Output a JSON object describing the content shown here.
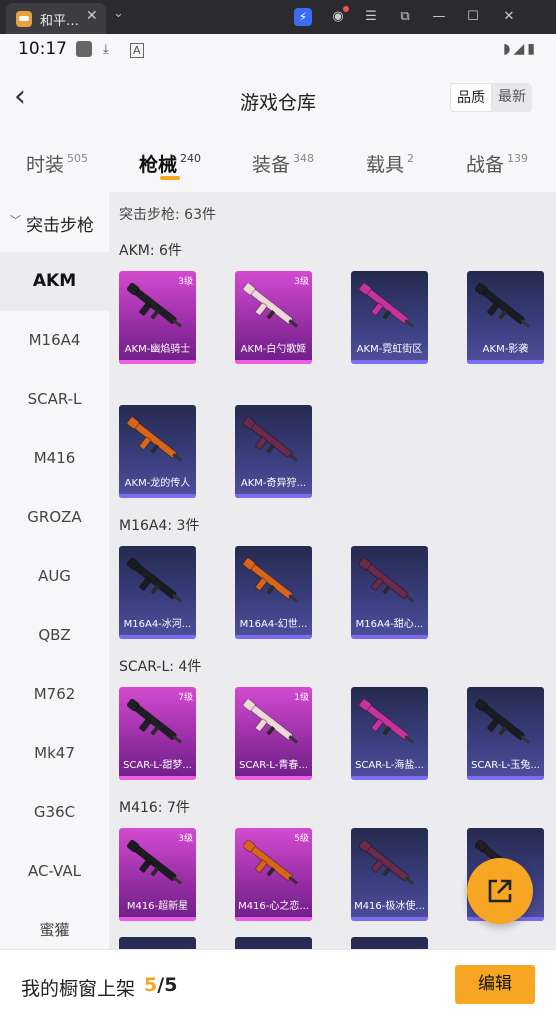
{
  "window": {
    "title": "和平…",
    "favicon": "game-app-icon"
  },
  "status_bar": {
    "time": "10:17"
  },
  "header": {
    "title": "游戏仓库",
    "sort": [
      "品质",
      "最新"
    ]
  },
  "categories": [
    {
      "label": "时装",
      "count": "505"
    },
    {
      "label": "枪械",
      "count": "240"
    },
    {
      "label": "装备",
      "count": "348"
    },
    {
      "label": "载具",
      "count": "2"
    },
    {
      "label": "战备",
      "count": "139"
    }
  ],
  "active_category": "枪械",
  "sidebar": {
    "group": "突击步枪",
    "items": [
      "AKM",
      "M16A4",
      "SCAR-L",
      "M416",
      "GROZA",
      "AUG",
      "QBZ",
      "M762",
      "Mk47",
      "G36C",
      "AC-VAL",
      "蜜獾"
    ],
    "active": "AKM"
  },
  "summary": "突击步枪: 63件",
  "sections": [
    {
      "title": "AKM: 6件",
      "items": [
        {
          "name": "AKM-幽焰骑士",
          "level": "3级",
          "rarity": "pink"
        },
        {
          "name": "AKM-白勺歌姬",
          "level": "3级",
          "rarity": "pink"
        },
        {
          "name": "AKM-霓虹街区",
          "level": "",
          "rarity": "blue"
        },
        {
          "name": "AKM-影袭",
          "level": "",
          "rarity": "blue"
        },
        {
          "name": "AKM-龙的传人",
          "level": "",
          "rarity": "blue"
        },
        {
          "name": "AKM-奇异狩...",
          "level": "",
          "rarity": "blue"
        }
      ]
    },
    {
      "title": "M16A4: 3件",
      "items": [
        {
          "name": "M16A4-冰河...",
          "level": "",
          "rarity": "blue"
        },
        {
          "name": "M16A4-幻世...",
          "level": "",
          "rarity": "blue"
        },
        {
          "name": "M16A4-甜心...",
          "level": "",
          "rarity": "blue"
        }
      ]
    },
    {
      "title": "SCAR-L: 4件",
      "items": [
        {
          "name": "SCAR-L-甜梦...",
          "level": "7级",
          "rarity": "pink"
        },
        {
          "name": "SCAR-L-青春...",
          "level": "1级",
          "rarity": "pink"
        },
        {
          "name": "SCAR-L-海盐...",
          "level": "",
          "rarity": "blue"
        },
        {
          "name": "SCAR-L-玉兔...",
          "level": "",
          "rarity": "blue"
        }
      ]
    },
    {
      "title": "M416: 7件",
      "items": [
        {
          "name": "M416-超新星",
          "level": "3级",
          "rarity": "pink"
        },
        {
          "name": "M416-心之恋...",
          "level": "5级",
          "rarity": "pink"
        },
        {
          "name": "M416-极冰使...",
          "level": "",
          "rarity": "blue"
        },
        {
          "name": "",
          "level": "",
          "rarity": "blue"
        }
      ]
    }
  ],
  "colors": {
    "accent": "#f6a623",
    "pink_card": "#b63cbf",
    "blue_card": "#2f3367"
  },
  "footer": {
    "label": "我的橱窗上架",
    "current": "5",
    "separator": "/",
    "total": "5",
    "edit_label": "编辑"
  },
  "fab": {
    "icon": "share-external-icon"
  }
}
